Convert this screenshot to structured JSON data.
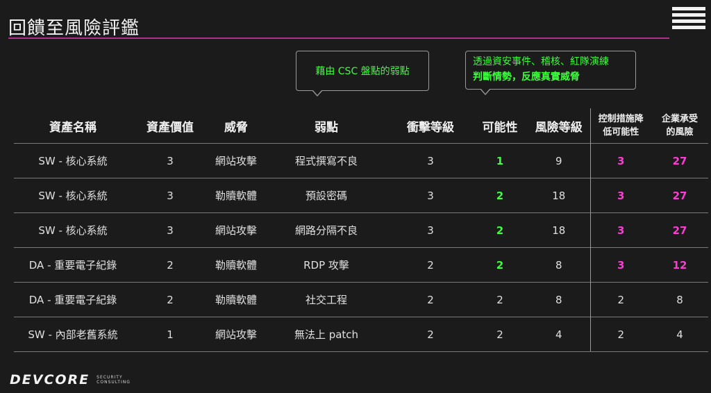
{
  "slide": {
    "title": "回饋至風險評鑑"
  },
  "callouts": {
    "csc": "藉由 CSC 盤點的弱點",
    "events_line1": "透過資安事件、稽核、紅隊演練",
    "events_line2": "判斷情勢，反應真實威脅"
  },
  "table": {
    "headers": {
      "asset": "資產名稱",
      "value": "資產價值",
      "threat": "威脅",
      "weakness": "弱點",
      "impact": "衝擊等級",
      "likelihood": "可能性",
      "risk": "風險等級",
      "control_l1": "控制措施降",
      "control_l2": "低可能性",
      "residual_l1": "企業承受",
      "residual_l2": "的風險"
    },
    "rows": [
      {
        "asset": "SW - 核心系統",
        "value": "3",
        "threat": "網站攻擊",
        "weakness": "程式撰寫不良",
        "impact": "3",
        "likelihood": "1",
        "risk": "9",
        "control": "3",
        "residual": "27"
      },
      {
        "asset": "SW - 核心系統",
        "value": "3",
        "threat": "勒贖軟體",
        "weakness": "預設密碼",
        "impact": "3",
        "likelihood": "2",
        "risk": "18",
        "control": "3",
        "residual": "27"
      },
      {
        "asset": "SW - 核心系統",
        "value": "3",
        "threat": "網站攻擊",
        "weakness": "網路分隔不良",
        "impact": "3",
        "likelihood": "2",
        "risk": "18",
        "control": "3",
        "residual": "27"
      },
      {
        "asset": "DA - 重要電子紀錄",
        "value": "2",
        "threat": "勒贖軟體",
        "weakness": "RDP 攻擊",
        "impact": "2",
        "likelihood": "2",
        "risk": "8",
        "control": "3",
        "residual": "12"
      },
      {
        "asset": "DA - 重要電子紀錄",
        "value": "2",
        "threat": "勒贖軟體",
        "weakness": "社交工程",
        "impact": "2",
        "likelihood": "2",
        "risk": "8",
        "control": "2",
        "residual": "8"
      },
      {
        "asset": "SW - 內部老舊系統",
        "value": "1",
        "threat": "網站攻擊",
        "weakness": "無法上 patch",
        "impact": "2",
        "likelihood": "2",
        "risk": "4",
        "control": "2",
        "residual": "4"
      }
    ]
  },
  "logo": {
    "wordmark": "DEVCORE",
    "sub1": "SECURITY",
    "sub2": "CONSULTING"
  },
  "colors": {
    "accent_line": "#b1308c",
    "green": "#3aff3a",
    "magenta": "#ff3bd6"
  }
}
